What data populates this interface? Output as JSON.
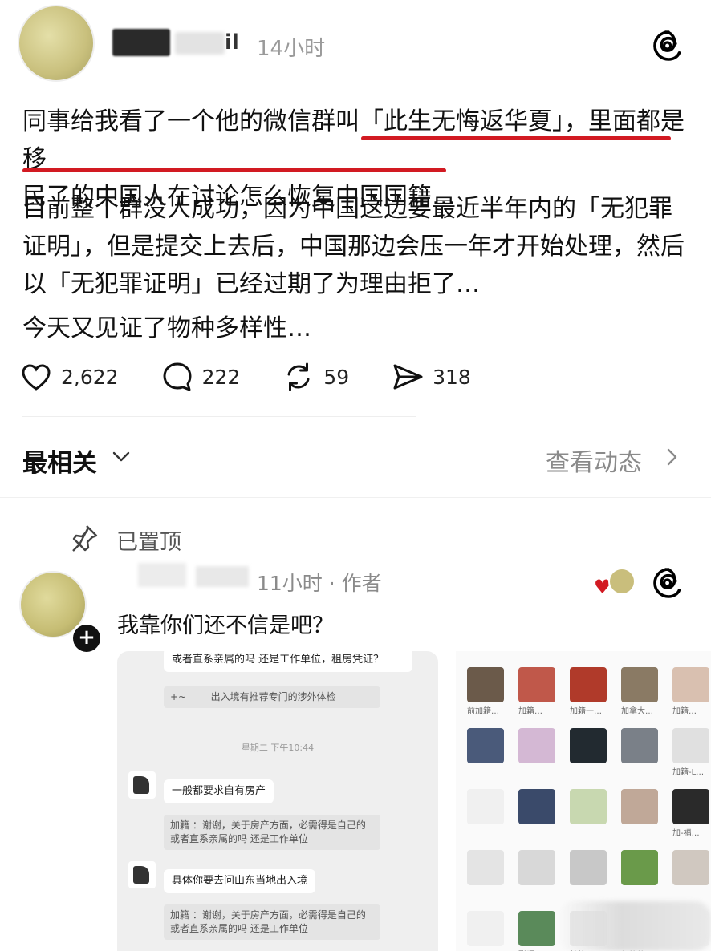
{
  "post": {
    "time": "14小时",
    "name_tail": "il",
    "p1_before": "同事给我看了一个他的微信群叫「",
    "p1_highlight": "此生无悔返华夏」，里面都是移",
    "p1_line2": "民了的中国人在讨论怎么恢复中国国籍…",
    "p2": "目前整个群没人成功，因为中国这边要最近半年内的「无犯罪证明」，但是提交上去后，中国那边会压一年才开始处理，然后以「无犯罪证明」已经过期了为理由拒了…",
    "p3": "今天又见证了物种多样性…",
    "highlight_color": "#d21a22"
  },
  "actions": {
    "likes": "2,622",
    "comments": "222",
    "reposts": "59",
    "shares": "318"
  },
  "sort": {
    "label": "最相关",
    "view_activity": "查看动态"
  },
  "pinned": {
    "label": "已置顶"
  },
  "reply": {
    "time": "11小时 · 作者",
    "text": "我靠你们还不信是吧？"
  },
  "chat": {
    "top_text": "或者直系亲属的吗 还是工作单位，租房凭证？",
    "top_quote": "出入境有推荐专门的涉外体检",
    "top_quote_prefix": "+~",
    "timestamp": "星期二 下午10:44",
    "msg1": "一般都要求自有房产",
    "quote1": "加籍 ：谢谢，关于房产方面，必需得是自己的或者直系亲属的吗 还是工作单位",
    "msg2": "具体你要去问山东当地出入境",
    "quote2": "加籍 ：谢谢，关于房产方面，必需得是自己的或者直系亲属的吗 还是工作单位"
  },
  "grid": {
    "labels": [
      "前加籍…",
      "加籍…",
      "加籍一…",
      "加拿大…",
      "加籍…",
      "",
      "",
      "",
      "",
      "加籍-L…",
      "",
      "",
      "",
      "",
      "加-福…",
      "",
      "",
      "",
      "",
      "",
      "",
      "聪明-…",
      "韩籍…",
      "加籍第…",
      ""
    ]
  },
  "colors": {
    "accent_red": "#d21a22",
    "muted": "#8a8a8a"
  }
}
